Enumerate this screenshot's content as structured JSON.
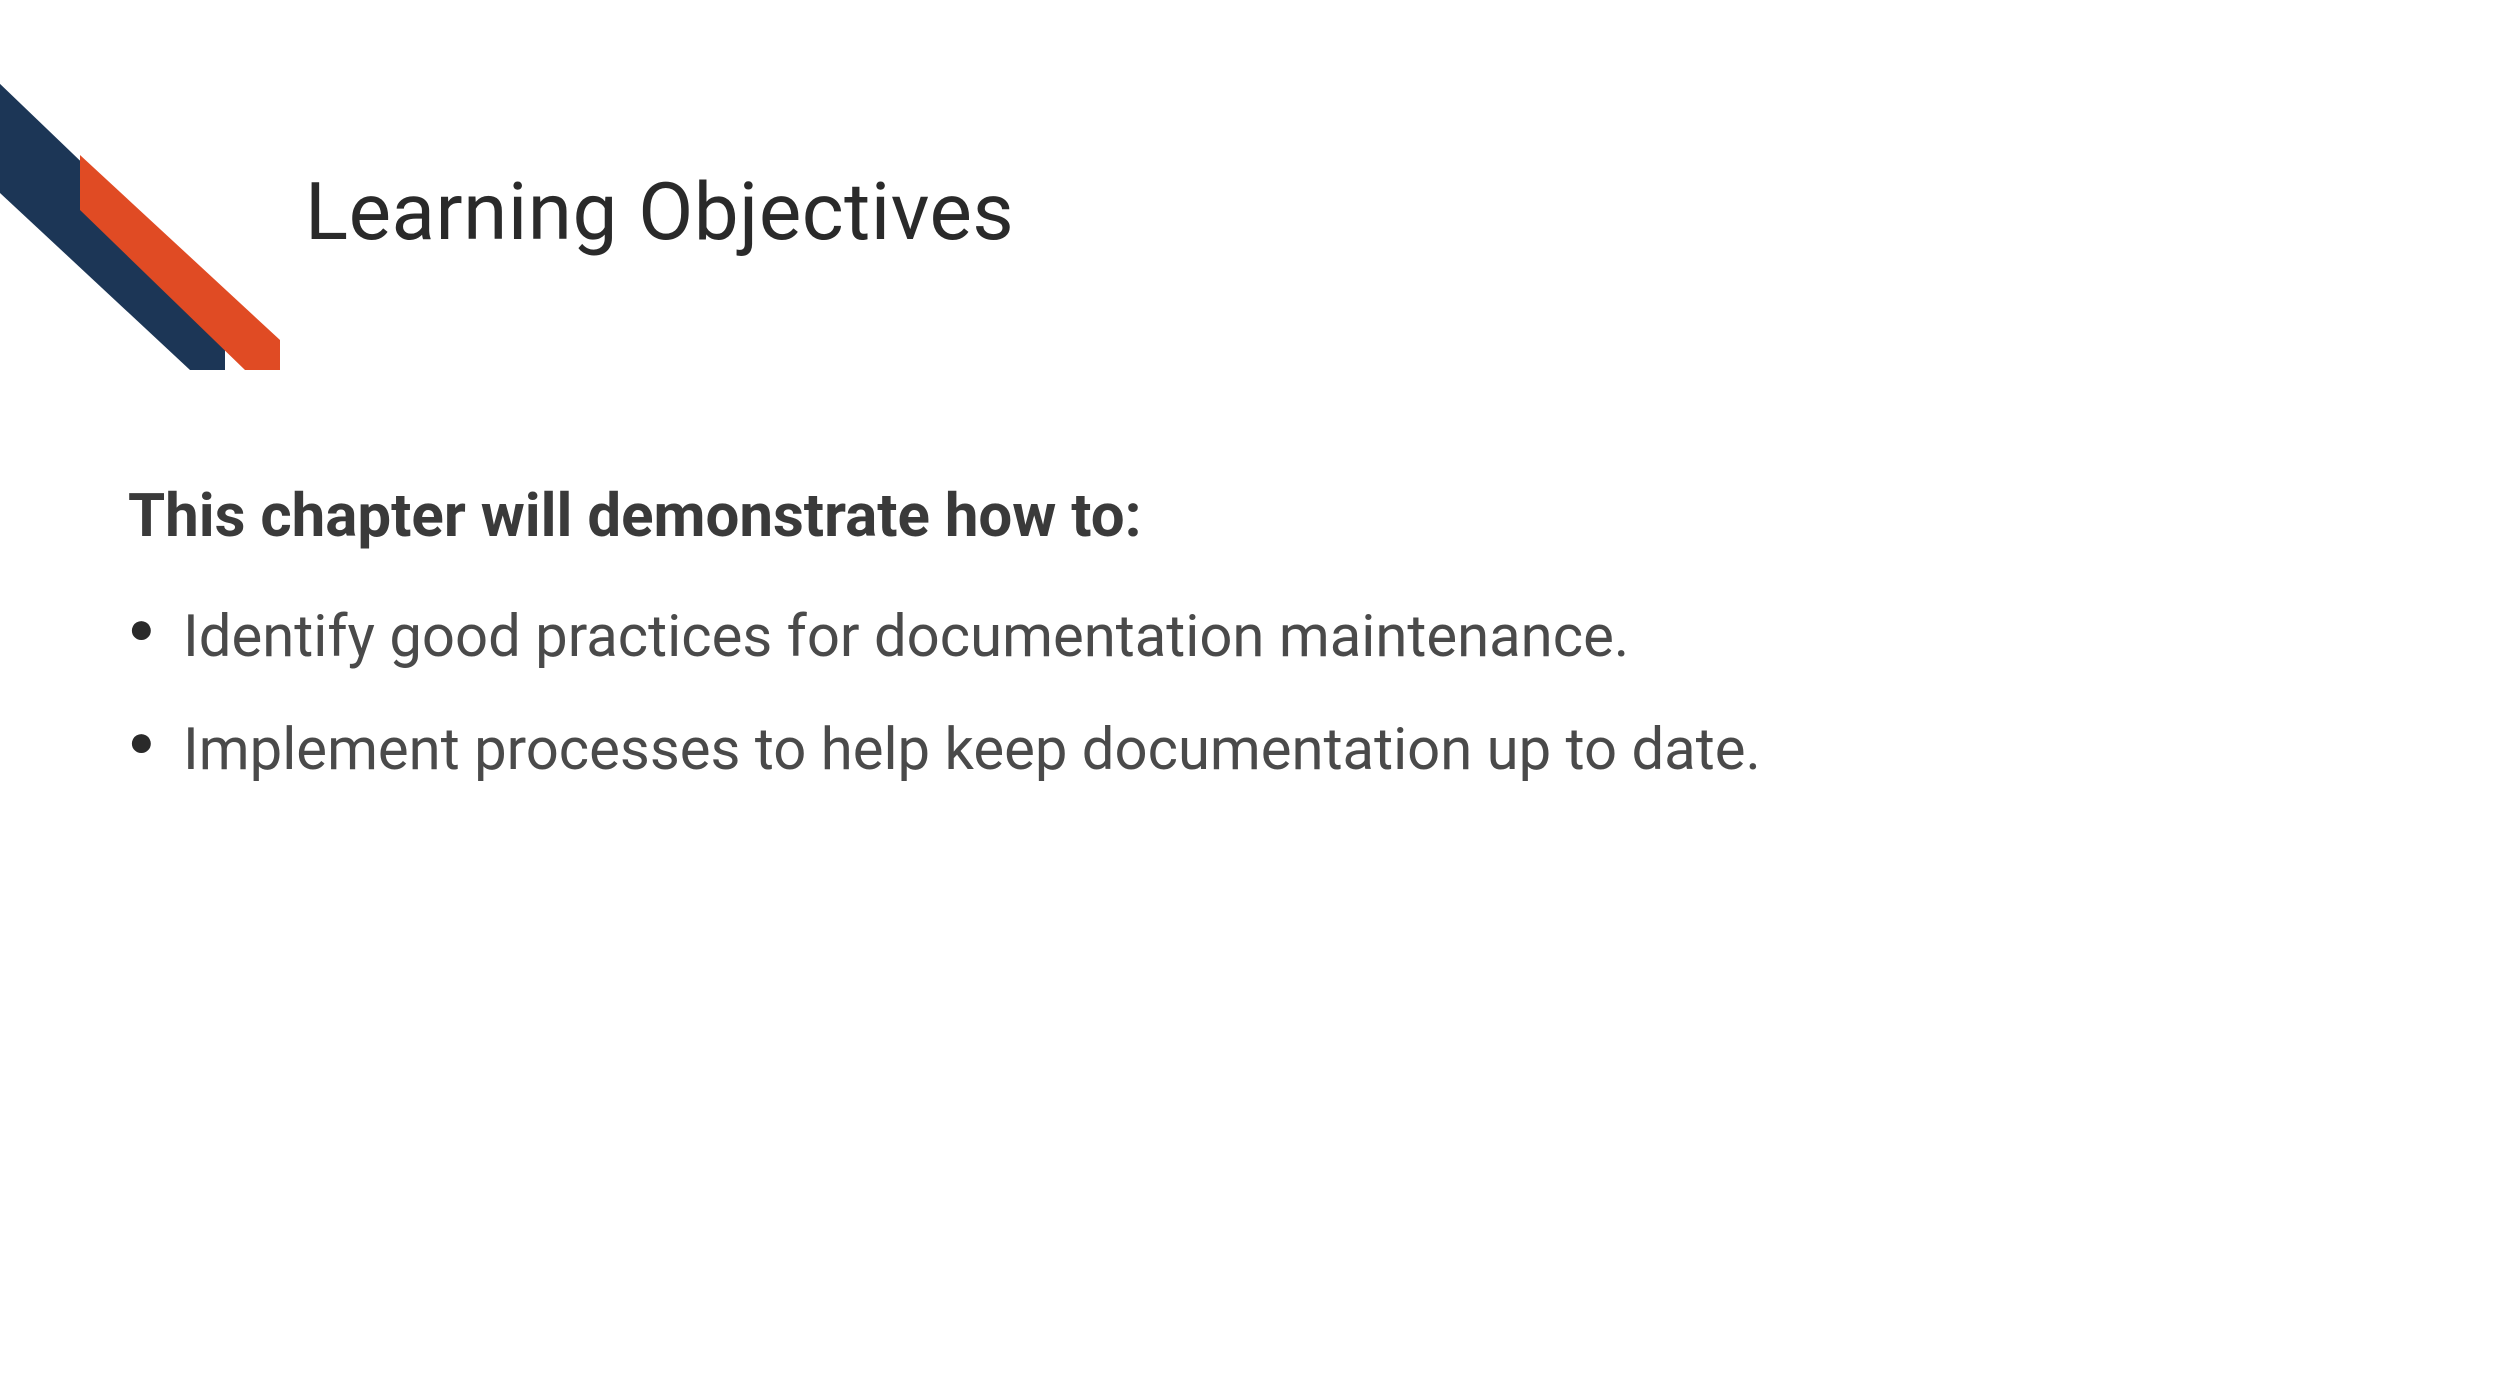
{
  "colors": {
    "navy": "#1c3656",
    "orange": "#e04b24"
  },
  "title": "Learning Objectives",
  "intro": "This chapter will demonstrate how to:",
  "bullets": [
    "Identify good practices for documentation maintenance.",
    "Implement processes to help keep documentation up to date."
  ]
}
